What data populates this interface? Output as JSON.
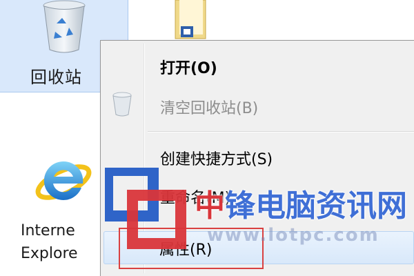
{
  "desktop": {
    "recycle_bin": {
      "label": "回收站",
      "icon": "recycle-bin-icon"
    },
    "folder": {
      "icon": "folder-icon"
    },
    "internet_explorer": {
      "label_line1": "Interne",
      "label_line2": "Explore",
      "icon": "internet-explorer-icon"
    }
  },
  "context_menu": {
    "items": [
      {
        "label": "打开(O)",
        "style": "bold"
      },
      {
        "label": "清空回收站(B)",
        "style": "disabled",
        "icon": "empty-recycle-bin-icon"
      },
      {
        "label": "创建快捷方式(S)",
        "style": "normal"
      },
      {
        "label": "重命名(M)",
        "style": "normal"
      },
      {
        "label": "属性(R)",
        "style": "normal",
        "highlighted": true
      }
    ]
  },
  "watermark": {
    "brand_red": "中",
    "brand_blue": "锋电脑资讯网",
    "url": "www.lotpc.com",
    "colors": {
      "red": "#d9353a",
      "blue": "#3f6fd6"
    }
  },
  "colors": {
    "highlight_box": "#d94040",
    "selection": "#d9e8fb",
    "menu_bg": "#f0f0f0"
  }
}
